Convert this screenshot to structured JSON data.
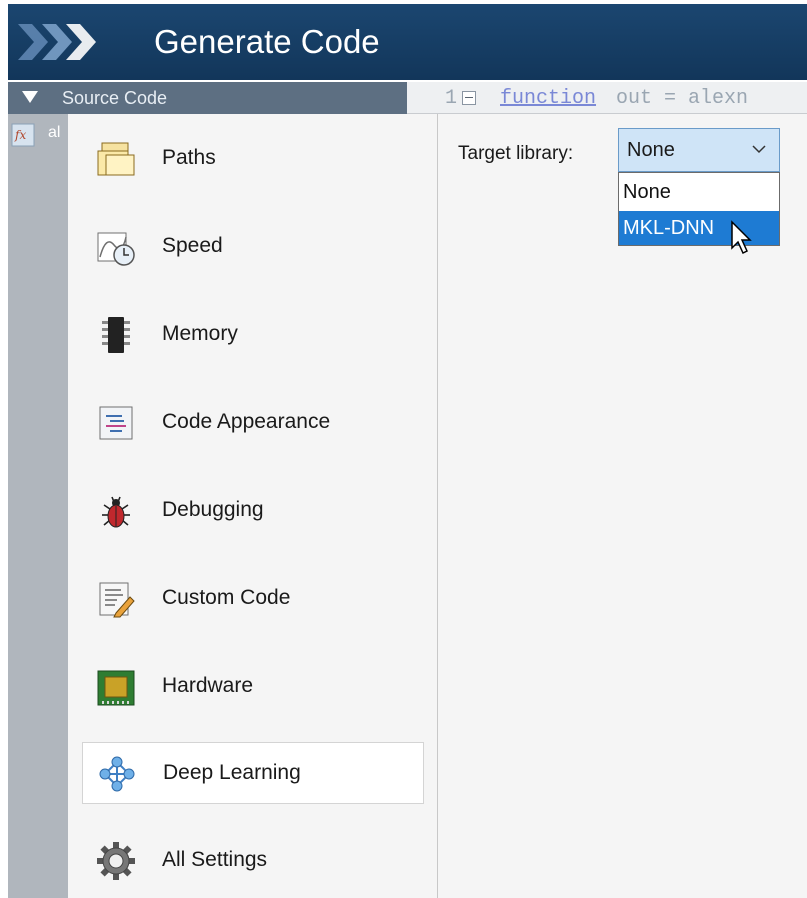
{
  "window": {
    "title": "Generate Code"
  },
  "source": {
    "section_label": "Source Code",
    "file_label": "al"
  },
  "code_preview": {
    "line_number": "1",
    "keyword": "function",
    "rest": " out = alexn"
  },
  "nav": {
    "items": [
      {
        "label": "Paths",
        "icon": "folder-icon"
      },
      {
        "label": "Speed",
        "icon": "speed-clock-icon"
      },
      {
        "label": "Memory",
        "icon": "memory-chip-icon"
      },
      {
        "label": "Code Appearance",
        "icon": "code-appearance-icon"
      },
      {
        "label": "Debugging",
        "icon": "bug-icon"
      },
      {
        "label": "Custom Code",
        "icon": "custom-code-icon"
      },
      {
        "label": "Hardware",
        "icon": "hardware-board-icon"
      },
      {
        "label": "Deep Learning",
        "icon": "deep-learning-network-icon",
        "selected": true
      },
      {
        "label": "All Settings",
        "icon": "gear-icon"
      }
    ]
  },
  "settings": {
    "target_library": {
      "label": "Target library:",
      "value": "None",
      "options": [
        "None",
        "MKL-DNN"
      ],
      "highlighted": "MKL-DNN"
    }
  },
  "colors": {
    "title_bar": "#143a5e",
    "highlight": "#1e7bd3",
    "combo_bg": "#cfe4f7"
  }
}
